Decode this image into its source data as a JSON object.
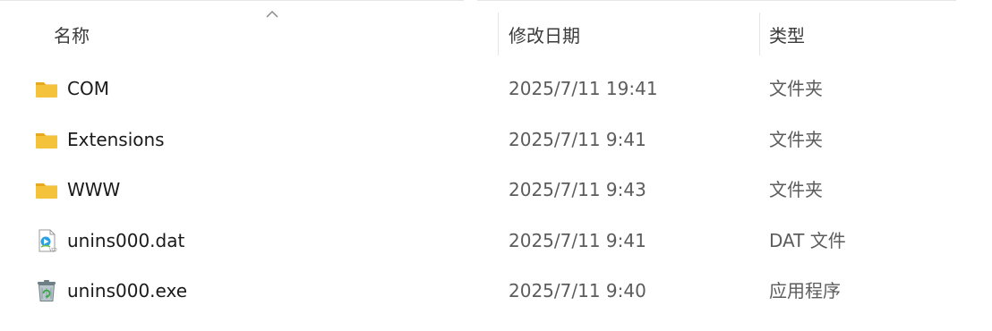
{
  "columns": {
    "name": "名称",
    "date_modified": "修改日期",
    "type": "类型",
    "sort": "ascending"
  },
  "files": [
    {
      "name": "COM",
      "modified": "2025/7/11 19:41",
      "type": "文件夹",
      "icon": "folder-icon"
    },
    {
      "name": "Extensions",
      "modified": "2025/7/11 9:41",
      "type": "文件夹",
      "icon": "folder-icon"
    },
    {
      "name": "WWW",
      "modified": "2025/7/11 9:43",
      "type": "文件夹",
      "icon": "folder-icon"
    },
    {
      "name": "unins000.dat",
      "modified": "2025/7/11 9:41",
      "type": "DAT 文件",
      "icon": "media-file-icon"
    },
    {
      "name": "unins000.exe",
      "modified": "2025/7/11 9:40",
      "type": "应用程序",
      "icon": "recycle-bin-icon"
    }
  ],
  "colors": {
    "folder": "#f5c33b",
    "folder_tab": "#e8a91f",
    "text_primary": "#1a1a1a",
    "text_secondary": "#5c5c5c"
  }
}
